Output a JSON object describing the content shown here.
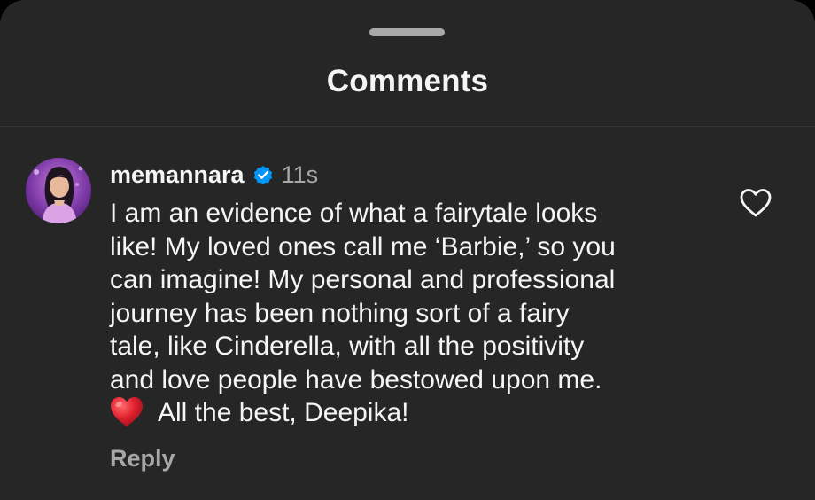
{
  "header": {
    "title": "Comments"
  },
  "comment": {
    "username": "memannara",
    "verified": true,
    "timestamp": "11s",
    "lines": [
      "I am an evidence of what a fairytale looks",
      "like! My loved ones call me ‘Barbie,’ so you",
      "can imagine! My personal and professional",
      "journey has been nothing sort of a fairy",
      "tale, like Cinderella, with all the positivity",
      "and love people have bestowed upon me."
    ],
    "last_line_emoji": "red-heart-emoji",
    "last_line_text": "All the best, Deepika!",
    "reply_label": "Reply",
    "liked": false
  },
  "icons": {
    "verified_badge": "verified-badge-icon",
    "like": "heart-outline-icon"
  },
  "colors": {
    "background": "#262626",
    "text_primary": "#f5f5f5",
    "text_secondary": "#a8a8a8",
    "verified_blue": "#0095f6",
    "emoji_red": "#e0202e"
  }
}
